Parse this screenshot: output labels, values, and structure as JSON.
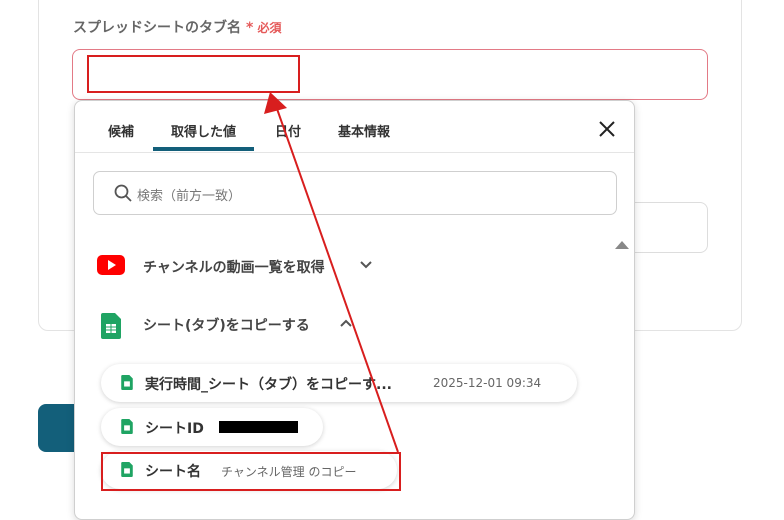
{
  "field": {
    "label": "スプレッドシートのタブ名",
    "required": "必須",
    "required_mark": "*"
  },
  "popup": {
    "tabs": [
      "候補",
      "取得した値",
      "日付",
      "基本情報"
    ],
    "active_tab": 1,
    "search_placeholder": "検索（前方一致）",
    "apps": [
      {
        "name": "チャンネルの動画一覧を取得",
        "icon": "youtube-icon",
        "expanded": false
      },
      {
        "name": "シート(タブ)をコピーする",
        "icon": "google-sheets-icon",
        "expanded": true
      }
    ],
    "values": [
      {
        "name": "実行時間_シート（タブ）をコピーす...",
        "value": "2025-12-01 09:34"
      },
      {
        "name": "シートID",
        "value": ""
      },
      {
        "name": "シート名",
        "value": "チャンネル管理 のコピー"
      }
    ]
  },
  "colors": {
    "accent": "#135f7a",
    "highlight": "#d81e1e",
    "required": "#e55a5a",
    "sheets_green": "#1fa463",
    "youtube_red": "#ff0000"
  }
}
